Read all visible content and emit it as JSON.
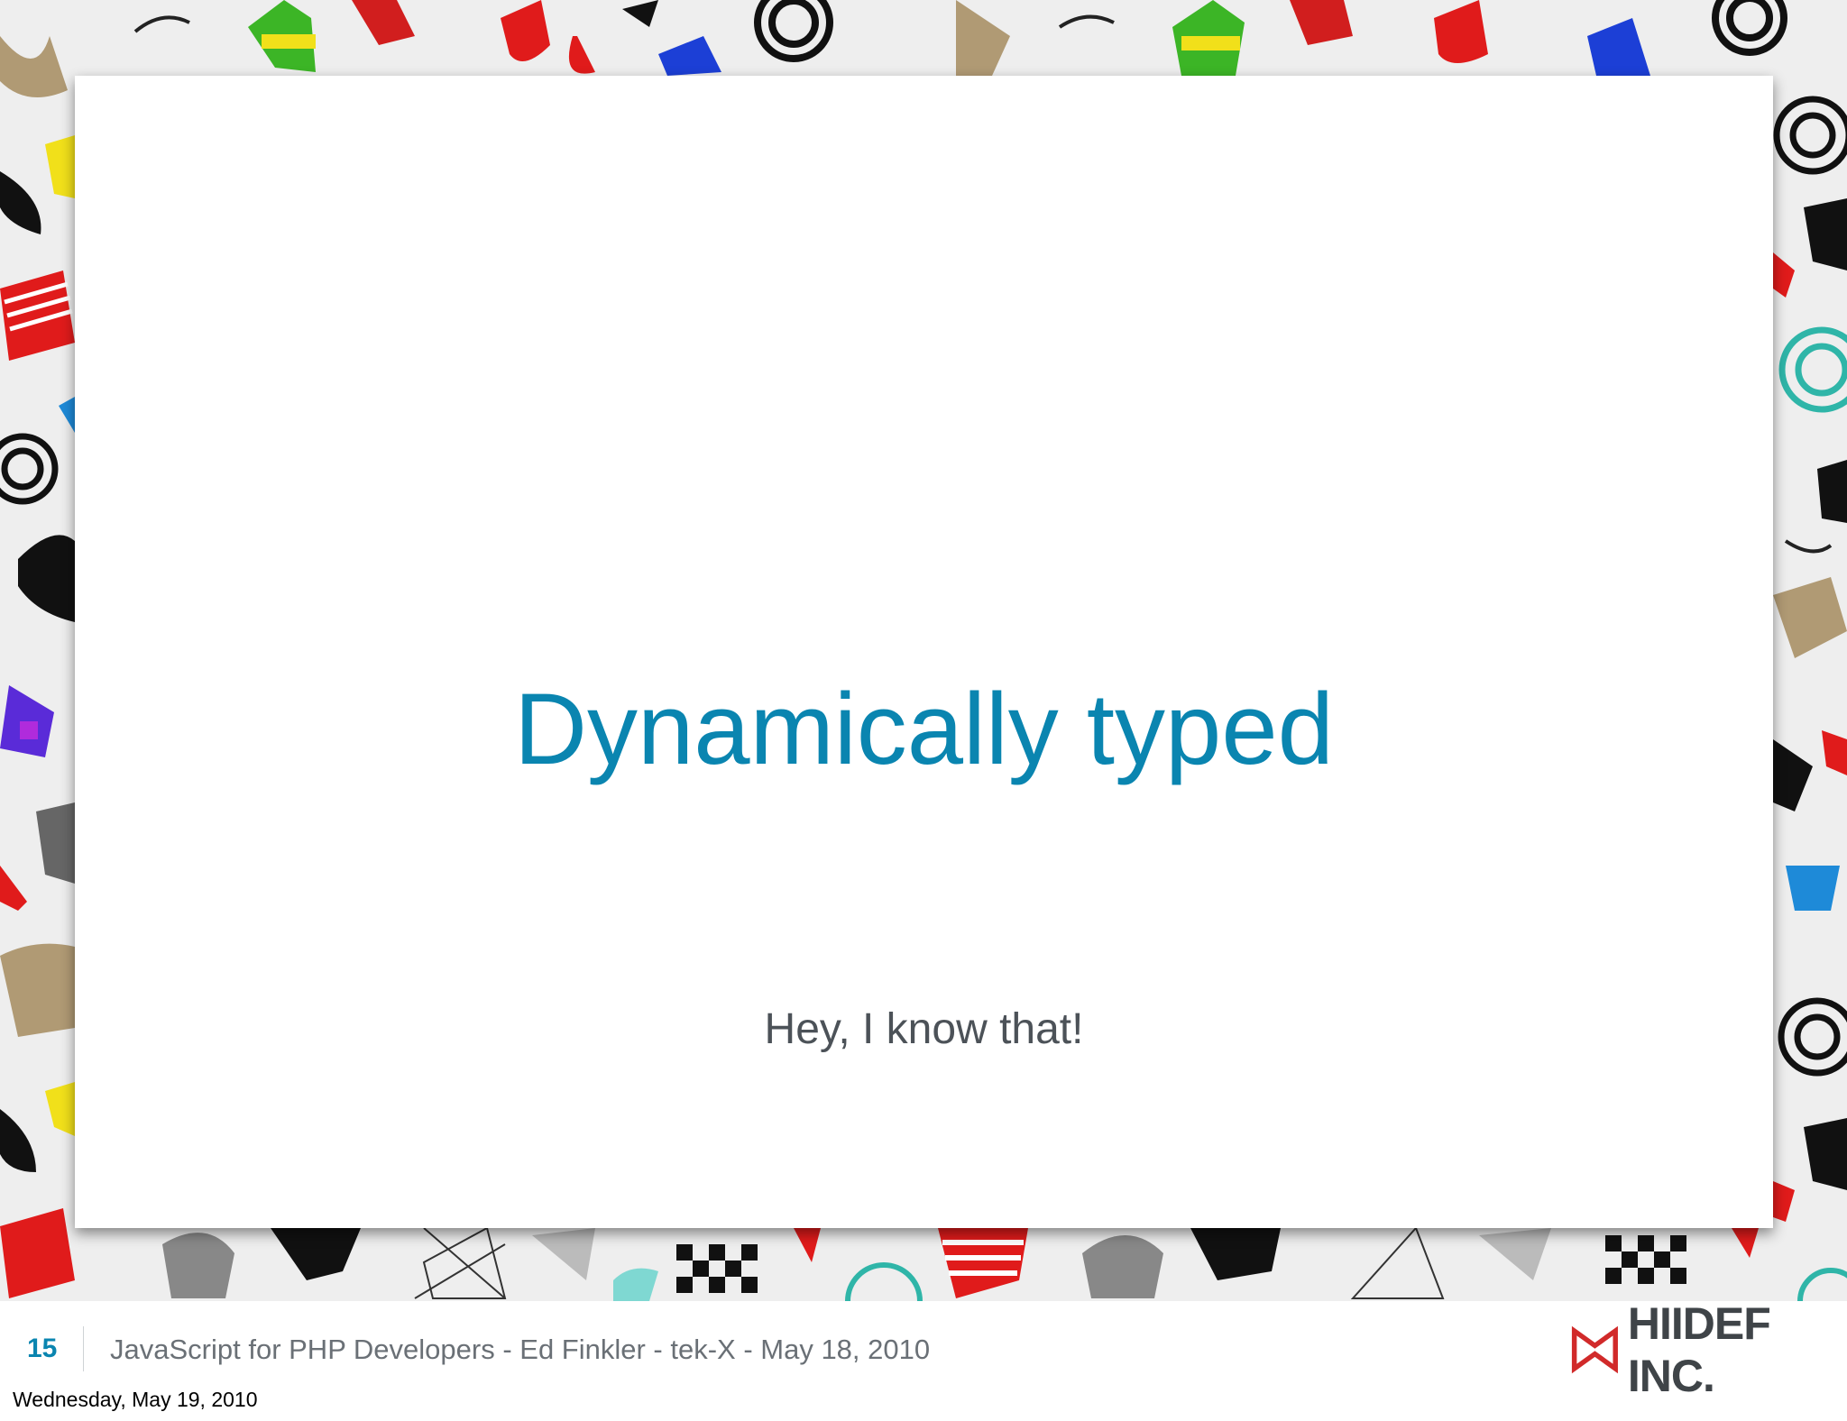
{
  "slide": {
    "title": "Dynamically typed",
    "subtitle": "Hey, I know that!"
  },
  "footer": {
    "slide_number": "15",
    "caption": "JavaScript for PHP Developers - Ed Finkler - tek-X - May 18, 2010",
    "brand": "HIIDEF INC.",
    "date_stamp": "Wednesday, May 19, 2010"
  },
  "colors": {
    "title": "#0a85b0",
    "subtitle": "#4c5258",
    "slide_number": "#0a85b0",
    "brand_mark": "#d12a2a"
  }
}
